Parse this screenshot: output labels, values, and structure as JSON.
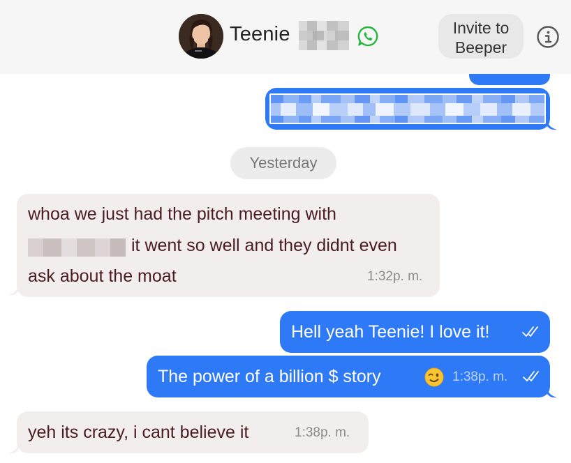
{
  "header": {
    "contact_name": "Teenie",
    "invite_label": "Invite to\nBeeper",
    "invite_line1": "Invite to",
    "invite_line2": "Beeper",
    "icons": [
      "avatar",
      "whatsapp-icon",
      "info-icon"
    ]
  },
  "colors": {
    "outgoing_bubble": "#2e79f6",
    "incoming_bubble": "#f3eeee",
    "incoming_text": "#4a1c22",
    "header_bg": "#f6f6f6",
    "whatsapp_green": "#25b63e"
  },
  "day_separator": "Yesterday",
  "messages": [
    {
      "direction": "in",
      "line1": "whoa we just had the pitch meeting with",
      "line2": "it went so well and they didnt even",
      "line3": "ask about the moat",
      "time": "1:32p. m."
    },
    {
      "direction": "out",
      "text": "Hell yeah Teenie! I love it!",
      "status": "read-check-icon"
    },
    {
      "direction": "out",
      "text": "The power of a billion $ story",
      "emoji": "😉",
      "time": "1:38p. m.",
      "status": "read-check-icon"
    },
    {
      "direction": "in",
      "text": "yeh its crazy, i cant believe it",
      "time": "1:38p. m."
    }
  ]
}
